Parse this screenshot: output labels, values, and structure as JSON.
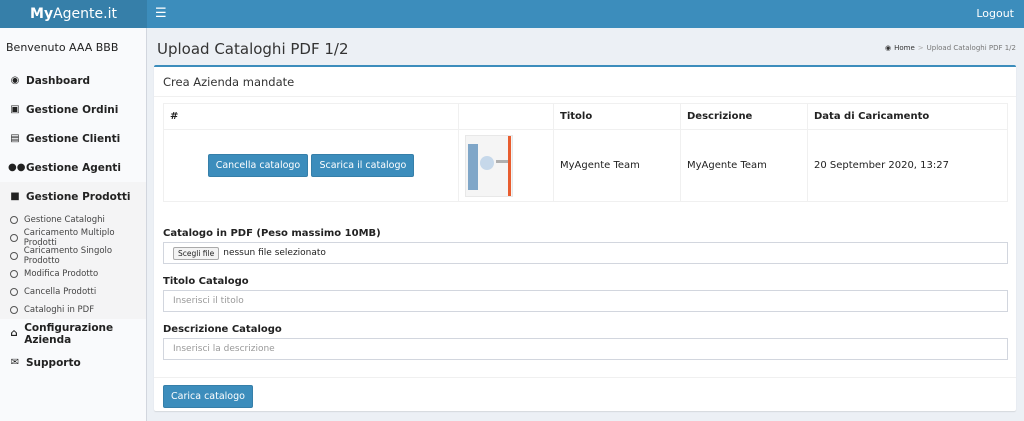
{
  "header": {
    "logo_bold": "My",
    "logo_rest": "Agente.it",
    "menu_icon": "hamburger-icon",
    "logout_label": "Logout"
  },
  "sidebar": {
    "welcome": "Benvenuto AAA BBB",
    "items": [
      {
        "label": "Dashboard",
        "icon": "dashboard-icon"
      },
      {
        "label": "Gestione Ordini",
        "icon": "inbox-icon"
      },
      {
        "label": "Gestione Clienti",
        "icon": "id-card-icon"
      },
      {
        "label": "Gestione Agenti",
        "icon": "users-icon"
      },
      {
        "label": "Gestione Prodotti",
        "icon": "shopping-bag-icon"
      },
      {
        "label": "Configurazione Azienda",
        "icon": "home-icon"
      },
      {
        "label": "Supporto",
        "icon": "comments-icon"
      }
    ],
    "subitems": [
      "Gestione Cataloghi",
      "Caricamento Multiplo Prodotti",
      "Caricamento Singolo Prodotto",
      "Modifica Prodotto",
      "Cancella Prodotti",
      "Cataloghi in PDF"
    ]
  },
  "page": {
    "title": "Upload Cataloghi PDF 1/2",
    "breadcrumb_home": "Home",
    "breadcrumb_current": "Upload Cataloghi PDF 1/2"
  },
  "box": {
    "title": "Crea Azienda mandate",
    "table": {
      "headers": [
        "#",
        "",
        "Titolo",
        "Descrizione",
        "Data di Caricamento"
      ],
      "rows": [
        {
          "delete_label": "Cancella catalogo",
          "download_label": "Scarica il catalogo",
          "title": "MyAgente Team",
          "description": "MyAgente Team",
          "date": "20 September 2020, 13:27"
        }
      ]
    },
    "form": {
      "pdf_label": "Catalogo in PDF (Peso massimo 10MB)",
      "file_button": "Scegli file",
      "file_status": "nessun file selezionato",
      "title_label": "Titolo Catalogo",
      "title_placeholder": "Inserisci il titolo",
      "description_label": "Descrizione Catalogo",
      "description_placeholder": "Inserisci la descrizione",
      "submit_label": "Carica catalogo"
    }
  },
  "colors": {
    "primary": "#3c8dbc",
    "logo_bg": "#367fa9",
    "content_bg": "#ecf0f5"
  }
}
